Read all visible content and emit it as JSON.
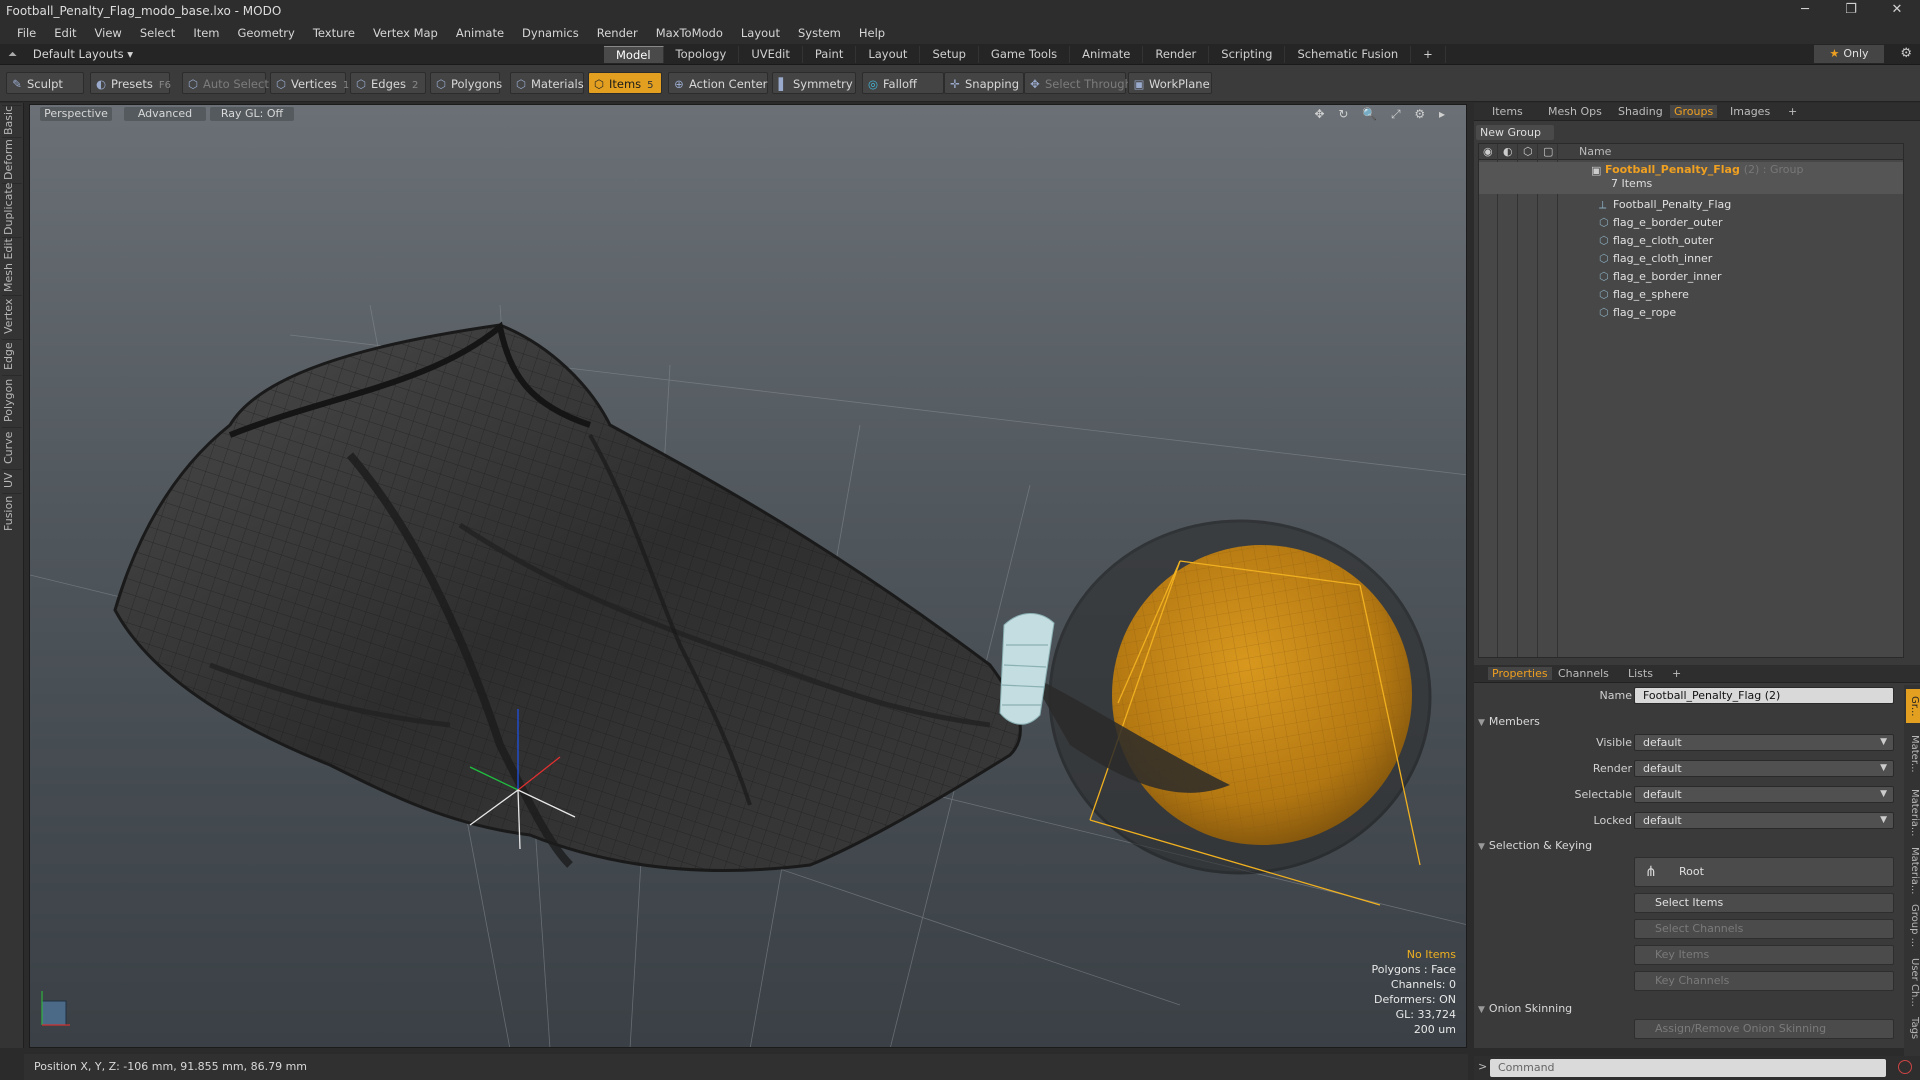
{
  "window": {
    "title": "Football_Penalty_Flag_modo_base.lxo - MODO",
    "minimize": "─",
    "restore": "❐",
    "close": "✕"
  },
  "menu": [
    "File",
    "Edit",
    "View",
    "Select",
    "Item",
    "Geometry",
    "Texture",
    "Vertex Map",
    "Animate",
    "Dynamics",
    "Render",
    "MaxToModo",
    "Layout",
    "System",
    "Help"
  ],
  "layout_selector": "Default Layouts ▾",
  "mode_tabs": [
    "Model",
    "Topology",
    "UVEdit",
    "Paint",
    "Layout",
    "Setup",
    "Game Tools",
    "Animate",
    "Render",
    "Scripting",
    "Schematic Fusion",
    "+"
  ],
  "mode_tabs_active": "Model",
  "only_button": "Only",
  "toolbar": {
    "sculpt": "Sculpt",
    "presets": "Presets",
    "presets_key": "F6",
    "auto_select": "Auto Select",
    "vertices": "Vertices",
    "vertices_key": "1",
    "edges": "Edges",
    "edges_key": "2",
    "polygons": "Polygons",
    "materials": "Materials",
    "items": "Items",
    "items_key": "5",
    "action_center": "Action Center",
    "symmetry": "Symmetry",
    "falloff": "Falloff",
    "snapping": "Snapping",
    "select_through": "Select Through",
    "workplane": "WorkPlane"
  },
  "left_tabs": [
    "Basic",
    "Deform",
    "Duplicate",
    "Mesh Edit",
    "Vertex",
    "Edge",
    "Polygon",
    "Curve",
    "UV",
    "Fusion"
  ],
  "viewport": {
    "perspective": "Perspective",
    "advanced": "Advanced",
    "raygl": "Ray GL: Off",
    "header_icons": "✥ ↻ 🔍 ⤢ ⚙ ▸",
    "info": {
      "no_items": "No Items",
      "polygons": "Polygons : Face",
      "channels": "Channels: 0",
      "deformers": "Deformers: ON",
      "gl": "GL: 33,724",
      "scale": "200 um"
    }
  },
  "right_panel": {
    "tabs": [
      "Items",
      "Mesh Ops",
      "Shading",
      "Groups",
      "Images",
      "+"
    ],
    "active_tab": "Groups",
    "new_group": "New Group",
    "name_column": "Name",
    "group": {
      "name": "Football_Penalty_Flag",
      "count": "(2) : Group",
      "items_count": "7 Items"
    },
    "items": [
      "Football_Penalty_Flag",
      "flag_e_border_outer",
      "flag_e_cloth_outer",
      "flag_e_cloth_inner",
      "flag_e_border_inner",
      "flag_e_sphere",
      "flag_e_rope"
    ]
  },
  "properties": {
    "tabs": [
      "Properties",
      "Channels",
      "Lists",
      "+"
    ],
    "active_tab": "Properties",
    "name_label": "Name",
    "name_value": "Football_Penalty_Flag (2)",
    "members_section": "Members",
    "visible_label": "Visible",
    "visible_value": "default",
    "render_label": "Render",
    "render_value": "default",
    "selectable_label": "Selectable",
    "selectable_value": "default",
    "locked_label": "Locked",
    "locked_value": "default",
    "selection_section": "Selection & Keying",
    "root_button": "Root",
    "select_items": "Select Items",
    "select_channels": "Select Channels",
    "key_items": "Key Items",
    "key_channels": "Key Channels",
    "onion_section": "Onion Skinning",
    "onion_button": "Assign/Remove Onion Skinning",
    "side_tabs": [
      "Gr...",
      "Mater...",
      "Materia...",
      "Materia...",
      "Group ...",
      "User Ch...",
      "Tags"
    ]
  },
  "command": {
    "prompt": ">",
    "placeholder": "Command"
  },
  "status": {
    "position": "Position X, Y, Z:  -106 mm, 91.855 mm, 86.79 mm"
  },
  "colors": {
    "accent": "#e3a020",
    "sphere": "#c88a1a",
    "cloth": "#3c3c3c",
    "rope": "#b8d4d8"
  }
}
